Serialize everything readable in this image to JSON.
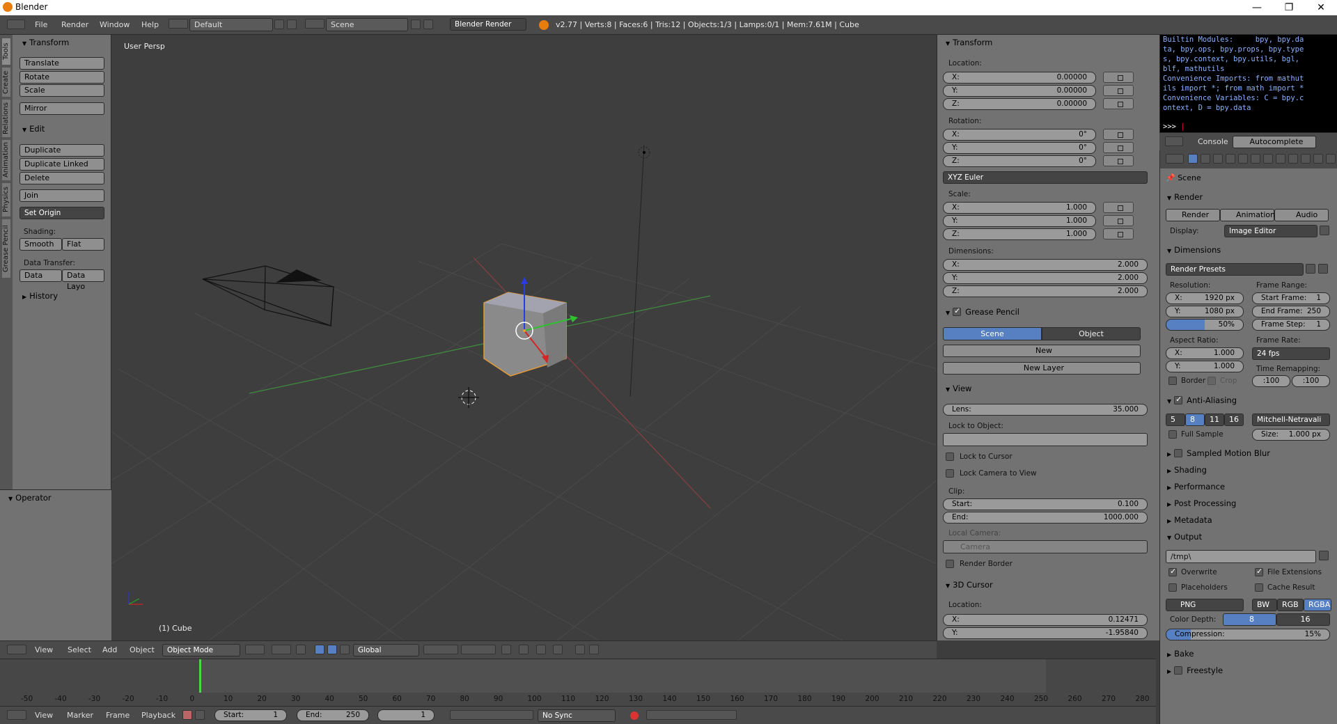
{
  "window": {
    "title": "Blender",
    "min": "—",
    "max": "❐",
    "close": "✕"
  },
  "info": {
    "menus": [
      "File",
      "Render",
      "Window",
      "Help"
    ],
    "layout": "Default",
    "scene": "Scene",
    "engine": "Blender Render",
    "stats": "v2.77 | Verts:8 | Faces:6 | Tris:12 | Objects:1/3 | Lamps:0/1 | Mem:7.61M | Cube"
  },
  "tabs": [
    "Tools",
    "Create",
    "Relations",
    "Animation",
    "Physics",
    "Grease Pencil"
  ],
  "tools": {
    "transform": "Transform",
    "translate": "Translate",
    "rotate": "Rotate",
    "scale": "Scale",
    "mirror": "Mirror",
    "edit": "Edit",
    "duplicate": "Duplicate",
    "duplicate_linked": "Duplicate Linked",
    "delete": "Delete",
    "join": "Join",
    "set_origin": "Set Origin",
    "shading": "Shading:",
    "smooth": "Smooth",
    "flat": "Flat",
    "data_transfer": "Data Transfer:",
    "data": "Data",
    "data_layo": "Data Layo",
    "history": "History",
    "operator": "Operator"
  },
  "viewport": {
    "persp": "User Persp",
    "object": "(1) Cube"
  },
  "vp_header": {
    "menus": [
      "View",
      "Select",
      "Add",
      "Object"
    ],
    "mode": "Object Mode",
    "orientation": "Global"
  },
  "props": {
    "transform": "Transform",
    "location": "Location:",
    "loc": [
      [
        "X:",
        "0.00000"
      ],
      [
        "Y:",
        "0.00000"
      ],
      [
        "Z:",
        "0.00000"
      ]
    ],
    "rotation": "Rotation:",
    "rot": [
      [
        "X:",
        "0°"
      ],
      [
        "Y:",
        "0°"
      ],
      [
        "Z:",
        "0°"
      ]
    ],
    "euler": "XYZ Euler",
    "scale": "Scale:",
    "scl": [
      [
        "X:",
        "1.000"
      ],
      [
        "Y:",
        "1.000"
      ],
      [
        "Z:",
        "1.000"
      ]
    ],
    "dimensions": "Dimensions:",
    "dim": [
      [
        "X:",
        "2.000"
      ],
      [
        "Y:",
        "2.000"
      ],
      [
        "Z:",
        "2.000"
      ]
    ],
    "grease": "Grease Pencil",
    "gp_scene": "Scene",
    "gp_object": "Object",
    "gp_new": "New",
    "gp_newlayer": "New Layer",
    "view": "View",
    "lens_l": "Lens:",
    "lens": "35.000",
    "lock_obj": "Lock to Object:",
    "lock_cursor": "Lock to Cursor",
    "lock_cam": "Lock Camera to View",
    "clip": "Clip:",
    "clip_start_l": "Start:",
    "clip_start": "0.100",
    "clip_end_l": "End:",
    "clip_end": "1000.000",
    "local_cam": "Local Camera:",
    "camera": "Camera",
    "render_border": "Render Border",
    "cursor3d": "3D Cursor",
    "cur_loc": "Location:",
    "cur": [
      [
        "X:",
        "0.12471"
      ],
      [
        "Y:",
        "-1.95840"
      ]
    ]
  },
  "console": {
    "lines": [
      "Builtin Modules:     bpy, bpy.da",
      "ta, bpy.ops, bpy.props, bpy.type",
      "s, bpy.context, bpy.utils, bgl,",
      "blf, mathutils",
      "Convenience Imports: from mathut",
      "ils import *; from math import *",
      "Convenience Variables: C = bpy.c",
      "ontext, D = bpy.data"
    ],
    "prompt": ">>> ",
    "tab_console": "Console",
    "tab_auto": "Autocomplete"
  },
  "render": {
    "scene": "Scene",
    "render": "Render",
    "btn_render": "Render",
    "btn_anim": "Animation",
    "btn_audio": "Audio",
    "display_l": "Display:",
    "display": "Image Editor",
    "dimensions": "Dimensions",
    "presets": "Render Presets",
    "res": "Resolution:",
    "res_x_l": "X:",
    "res_x": "1920 px",
    "res_y_l": "Y:",
    "res_y": "1080 px",
    "pct": "50%",
    "frange": "Frame Range:",
    "start_l": "Start Frame:",
    "start": "1",
    "end_l": "End Frame:",
    "end": "250",
    "step_l": "Frame Step:",
    "step": "1",
    "aspect": "Aspect Ratio:",
    "asp_x": "1.000",
    "asp_y": "1.000",
    "frate": "Frame Rate:",
    "fps": "24 fps",
    "remap": "Time Remapping:",
    "remap_a": ":100",
    "remap_b": ":100",
    "border": "Border",
    "crop": "Crop",
    "aa": "Anti-Aliasing",
    "aa_s": [
      "5",
      "8",
      "11",
      "16"
    ],
    "filter": "Mitchell-Netravali",
    "full": "Full Sample",
    "size_l": "Size:",
    "size": "1.000 px",
    "smb": "Sampled Motion Blur",
    "shading": "Shading",
    "perf": "Performance",
    "post": "Post Processing",
    "meta": "Metadata",
    "output": "Output",
    "path": "/tmp\\",
    "overwrite": "Overwrite",
    "file_ext": "File Extensions",
    "placeholders": "Placeholders",
    "cache": "Cache Result",
    "format": "PNG",
    "bw": "BW",
    "rgb": "RGB",
    "rgba": "RGBA",
    "depth_l": "Color Depth:",
    "d8": "8",
    "d16": "16",
    "comp_l": "Compression:",
    "comp": "15%",
    "bake": "Bake",
    "freestyle": "Freestyle"
  },
  "timeline": {
    "ticks": [
      "-50",
      "-40",
      "-30",
      "-20",
      "-10",
      "0",
      "10",
      "20",
      "30",
      "40",
      "50",
      "60",
      "70",
      "80",
      "90",
      "100",
      "110",
      "120",
      "130",
      "140",
      "150",
      "160",
      "170",
      "180",
      "190",
      "200",
      "210",
      "220",
      "230",
      "240",
      "250",
      "260",
      "270",
      "280"
    ],
    "menus": [
      "View",
      "Marker",
      "Frame",
      "Playback"
    ],
    "start_l": "Start:",
    "start": "1",
    "end_l": "End:",
    "end": "250",
    "cur": "1",
    "sync": "No Sync"
  }
}
